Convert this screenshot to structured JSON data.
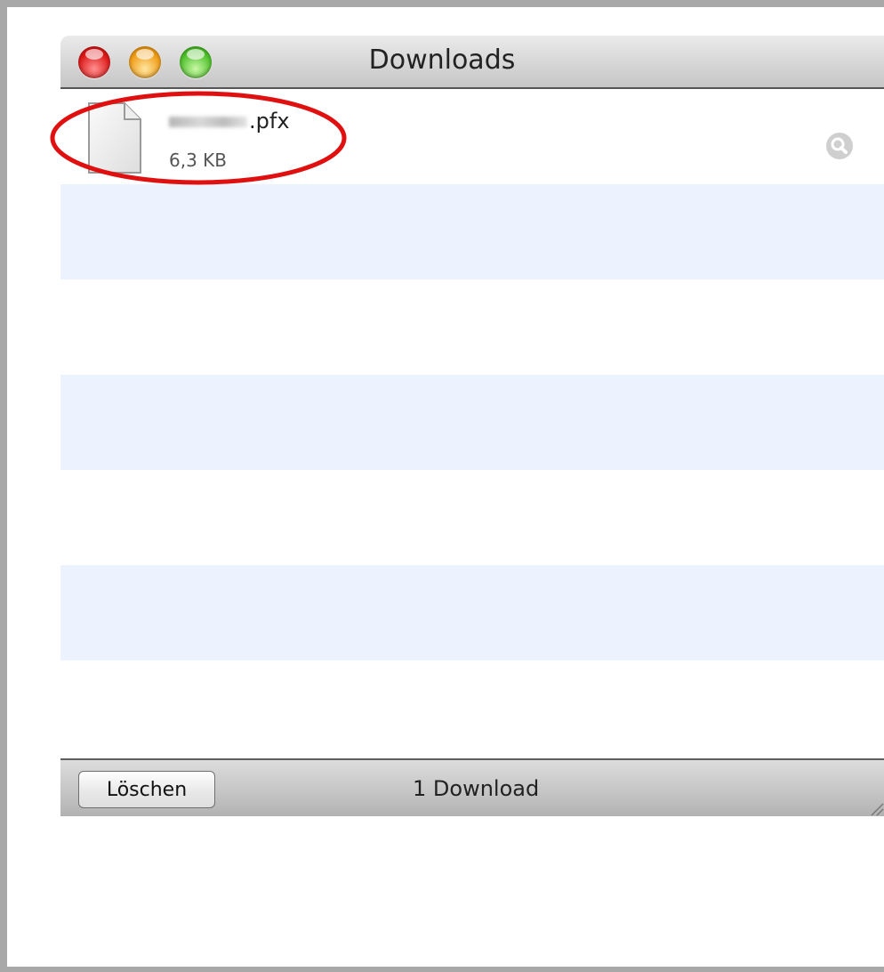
{
  "window": {
    "title": "Downloads"
  },
  "downloads": [
    {
      "name_suffix": ".pfx",
      "size": "6,3 KB",
      "icon": "document-icon",
      "action_icon": "magnifier-reveal-icon"
    }
  ],
  "footer": {
    "clear_label": "Löschen",
    "status": "1 Download"
  },
  "annotation": {
    "shape": "ellipse",
    "color": "#e01010"
  },
  "colors": {
    "alt_row": "#ecf3fe",
    "traffic_close": "#dd1a1a",
    "traffic_minimize": "#f09d17",
    "traffic_zoom": "#52c22e"
  }
}
